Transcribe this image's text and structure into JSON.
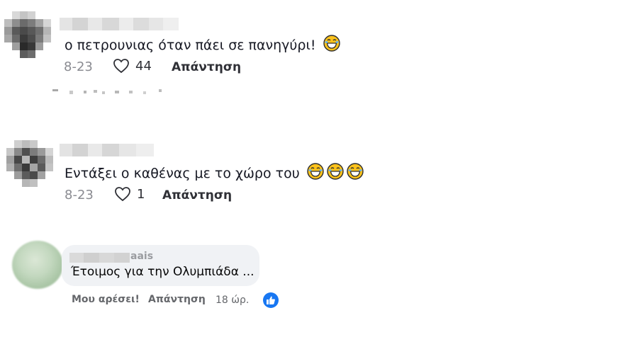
{
  "comments": [
    {
      "text": "ο πετρουνιας όταν πάει σε πανηγύρι!",
      "emojis": [
        "laughing-tears"
      ],
      "date": "8-23",
      "likes": "44",
      "reply_label": "Απάντηση"
    },
    {
      "text": "Εντάξει ο καθένας με το χώρο του",
      "emojis": [
        "laughing-tears",
        "laughing-tears",
        "laughing-tears"
      ],
      "date": "8-23",
      "likes": "1",
      "reply_label": "Απάντηση"
    }
  ],
  "fb_comment": {
    "name_fragment": "aais",
    "text": "Έτοιμος για την Ολυμπιάδα ...",
    "like_label": "Μου αρέσει!",
    "reply_label": "Απάντηση",
    "time": "18 ώρ."
  },
  "colors": {
    "emoji_face": "#fcc21b",
    "fb_blue": "#1877f2"
  }
}
